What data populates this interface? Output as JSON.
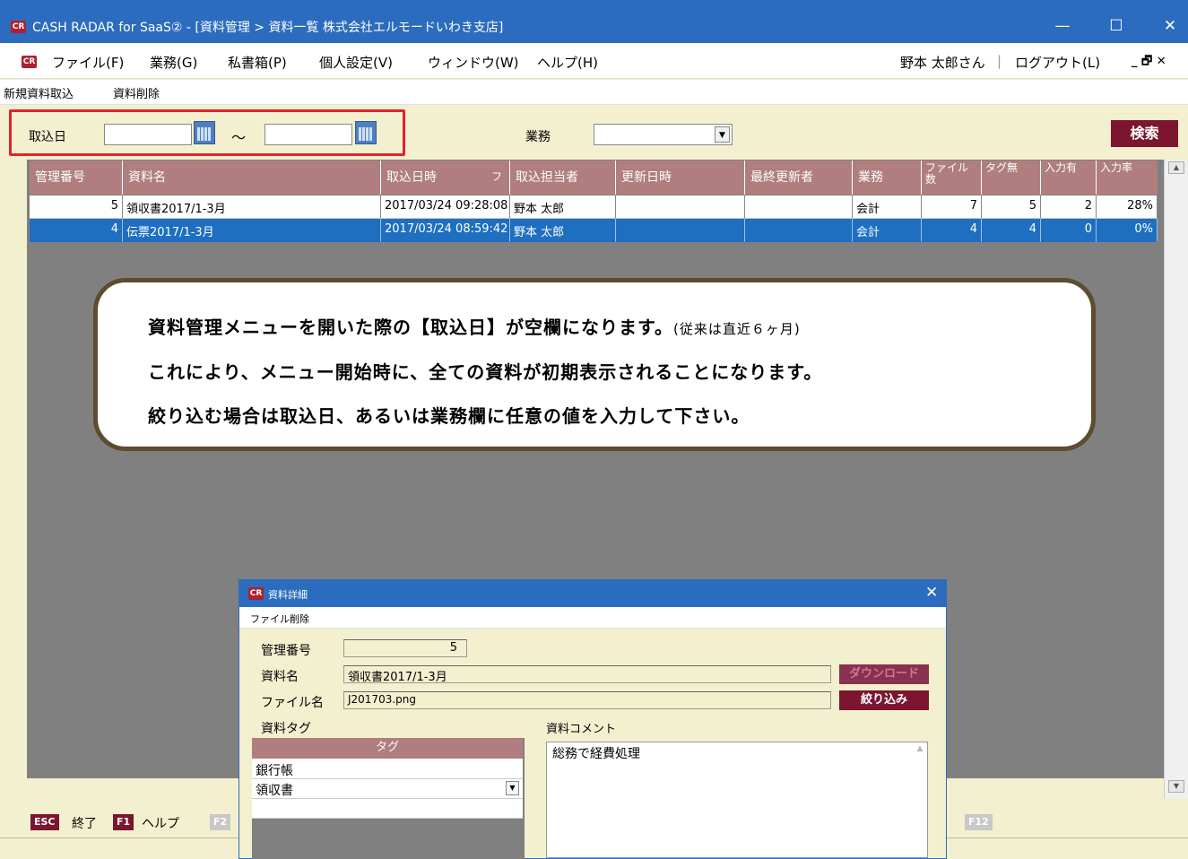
{
  "window": {
    "logo": "CR",
    "title": "CASH RADAR for SaaS② - [資料管理 > 資料一覧 株式会社エルモードいわき支店]",
    "minimize": "—",
    "maximize": "☐",
    "close": "✕"
  },
  "menubar": {
    "items": [
      "ファイル(F)",
      "業務(G)",
      "私書箱(P)",
      "個人設定(V)",
      "ウィンドウ(W)",
      "ヘルプ(H)"
    ],
    "user": "野本 太郎さん",
    "separator": "|",
    "logout": "ログアウト(L)",
    "mdi_controls": "_ 🗗 ✕"
  },
  "toolbar": {
    "new_import": "新規資料取込",
    "delete": "資料削除"
  },
  "filter": {
    "import_date_label": "取込日",
    "date_from": "",
    "date_to": "",
    "range_sep": "～",
    "business_label": "業務",
    "business_value": "",
    "search_button": "検索"
  },
  "grid": {
    "headers": [
      "管理番号",
      "資料名",
      "取込日時",
      "取込担当者",
      "更新日時",
      "最終更新者",
      "業務",
      "ファイル数",
      "タグ無",
      "入力有",
      "入力率"
    ],
    "sort_marker": "フ",
    "rows": [
      {
        "id": "5",
        "name": "領収書2017/1-3月",
        "imported": "2017/03/24 09:28:08",
        "importer": "野本 太郎",
        "updated": "",
        "updater": "",
        "business": "会計",
        "files": "7",
        "untagged": "5",
        "entered": "2",
        "rate": "28%"
      },
      {
        "id": "4",
        "name": "伝票2017/1-3月",
        "imported": "2017/03/24 08:59:42",
        "importer": "野本 太郎",
        "updated": "",
        "updater": "",
        "business": "会計",
        "files": "4",
        "untagged": "4",
        "entered": "0",
        "rate": "0%"
      }
    ],
    "selected_row": 1
  },
  "callout": {
    "line1": "資料管理メニューを開いた際の【取込日】が空欄になります。",
    "line1_note": "(従来は直近６ヶ月)",
    "line2": "これにより、メニュー開始時に、全ての資料が初期表示されることになります。",
    "line3": "絞り込む場合は取込日、あるいは業務欄に任意の値を入力して下さい。"
  },
  "function_keys": {
    "esc_key": "ESC",
    "esc_label": "終了",
    "f1_key": "F1",
    "f1_label": "ヘルプ",
    "f2_key": "F2",
    "f12_key": "F12"
  },
  "dialog": {
    "title": "資料詳細",
    "close": "✕",
    "menu_delete_file": "ファイル削除",
    "id_label": "管理番号",
    "id_value": "5",
    "name_label": "資料名",
    "name_value": "領収書2017/1-3月",
    "file_label": "ファイル名",
    "file_value": "J201703.png",
    "download_button": "ダウンロード",
    "filter_button": "絞り込み",
    "tags_label": "資料タグ",
    "tags_header": "タグ",
    "tags": [
      "銀行帳",
      "領収書"
    ],
    "comment_label": "資料コメント",
    "comment_value": "総務で経費処理"
  },
  "colors": {
    "titlebar": "#2b6cbf",
    "window_bg": "#f3f0cf",
    "grid_header": "#b07e7e",
    "selection": "#1e6fc0",
    "accent_button": "#7b1530",
    "highlight_frame": "#e8202a",
    "callout_border": "#5c4d2e"
  }
}
